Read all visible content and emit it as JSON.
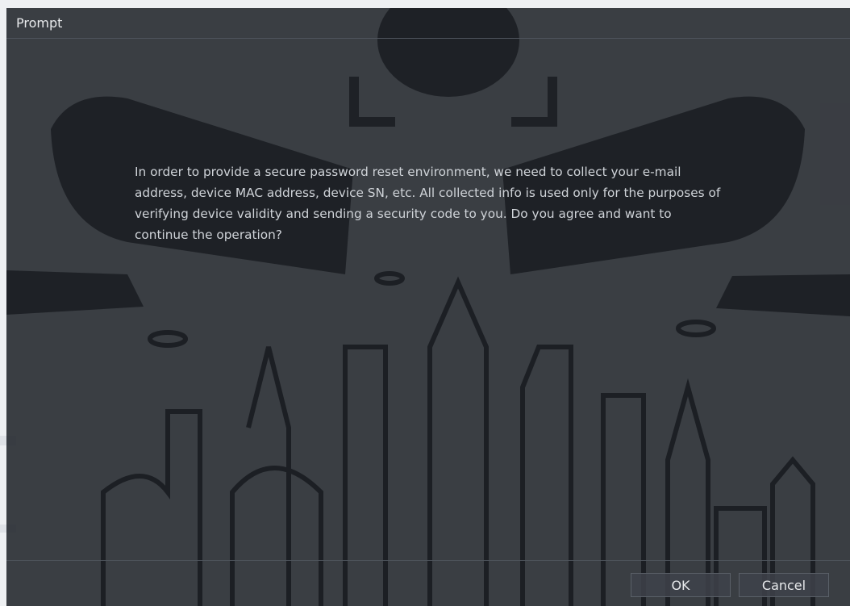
{
  "dialog": {
    "title": "Prompt",
    "message": "In order to provide a secure password reset environment, we need to collect your e-mail address, device MAC address, device SN, etc. All collected info is used only for the purposes of verifying device validity and sending a security code to you. Do you agree and want to continue the operation?",
    "ok_label": "OK",
    "cancel_label": "Cancel"
  },
  "colors": {
    "dialog_background": "#262a30",
    "text": "#cfd3d8",
    "title_text": "#e8eaec",
    "art": "#1f2227"
  },
  "background_art": {
    "icons": [
      "security-camera-icon",
      "city-skyline-illustration"
    ]
  }
}
